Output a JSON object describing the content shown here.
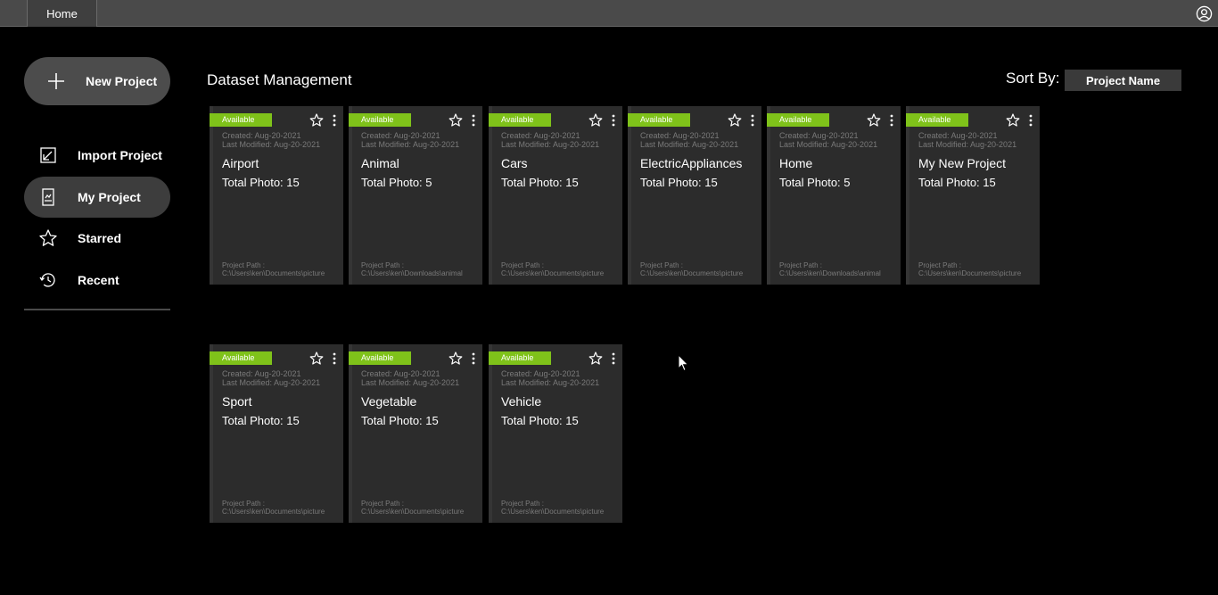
{
  "topbar": {
    "tab_home": "Home"
  },
  "sidebar": {
    "new_project": "New Project",
    "items": [
      {
        "label": "Import Project",
        "icon": "import-icon",
        "active": false
      },
      {
        "label": "My Project",
        "icon": "my-project-icon",
        "active": true
      },
      {
        "label": "Starred",
        "icon": "star-icon",
        "active": false
      },
      {
        "label": "Recent",
        "icon": "history-icon",
        "active": false
      }
    ]
  },
  "main": {
    "title": "Dataset Management",
    "sort_label": "Sort By:",
    "sort_value": "Project Name"
  },
  "projects": [
    {
      "status": "Available",
      "created": "Created: Aug-20-2021",
      "modified": "Last Modified: Aug-20-2021",
      "name": "Airport",
      "total": "Total Photo: 15",
      "path_label": "Project Path :",
      "path": "C:\\Users\\ken\\Documents\\picture"
    },
    {
      "status": "Available",
      "created": "Created: Aug-20-2021",
      "modified": "Last Modified: Aug-20-2021",
      "name": "Animal",
      "total": "Total Photo: 5",
      "path_label": "Project Path :",
      "path": "C:\\Users\\ken\\Downloads\\animal"
    },
    {
      "status": "Available",
      "created": "Created: Aug-20-2021",
      "modified": "Last Modified: Aug-20-2021",
      "name": "Cars",
      "total": "Total Photo: 15",
      "path_label": "Project Path :",
      "path": "C:\\Users\\ken\\Documents\\picture"
    },
    {
      "status": "Available",
      "created": "Created: Aug-20-2021",
      "modified": "Last Modified: Aug-20-2021",
      "name": "ElectricAppliances",
      "total": "Total Photo: 15",
      "path_label": "Project Path :",
      "path": "C:\\Users\\ken\\Documents\\picture"
    },
    {
      "status": "Available",
      "created": "Created: Aug-20-2021",
      "modified": "Last Modified: Aug-20-2021",
      "name": "Home",
      "total": "Total Photo: 5",
      "path_label": "Project Path :",
      "path": "C:\\Users\\ken\\Downloads\\animal"
    },
    {
      "status": "Available",
      "created": "Created: Aug-20-2021",
      "modified": "Last Modified: Aug-20-2021",
      "name": "My New Project",
      "total": "Total Photo: 15",
      "path_label": "Project Path :",
      "path": "C:\\Users\\ken\\Documents\\picture"
    },
    {
      "status": "Available",
      "created": "Created: Aug-20-2021",
      "modified": "Last Modified: Aug-20-2021",
      "name": "Sport",
      "total": "Total Photo: 15",
      "path_label": "Project Path :",
      "path": "C:\\Users\\ken\\Documents\\picture"
    },
    {
      "status": "Available",
      "created": "Created: Aug-20-2021",
      "modified": "Last Modified: Aug-20-2021",
      "name": "Vegetable",
      "total": "Total Photo: 15",
      "path_label": "Project Path :",
      "path": "C:\\Users\\ken\\Documents\\picture"
    },
    {
      "status": "Available",
      "created": "Created: Aug-20-2021",
      "modified": "Last Modified: Aug-20-2021",
      "name": "Vehicle",
      "total": "Total Photo: 15",
      "path_label": "Project Path :",
      "path": "C:\\Users\\ken\\Documents\\picture"
    }
  ],
  "colors": {
    "badge": "#7fc21a",
    "card": "#2c2c2c",
    "topbar": "#4a4a4a"
  }
}
